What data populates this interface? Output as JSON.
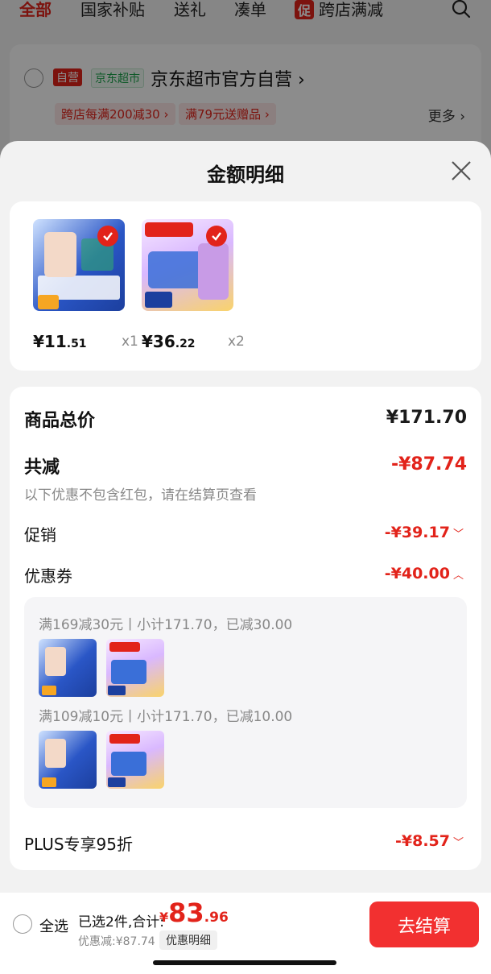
{
  "background": {
    "tabs": [
      "全部",
      "国家补贴",
      "送礼",
      "凑单"
    ],
    "promo_tab_badge": "促",
    "promo_tab_label": "跨店满减",
    "store": {
      "tag_self": "自营",
      "tag_supermarket": "京东超市",
      "name": "京东超市官方自营",
      "promos": [
        "跨店每满200减30",
        "满79元送赠品"
      ],
      "more": "更多"
    }
  },
  "sheet": {
    "title": "金额明细",
    "products": [
      {
        "price_int": "¥11",
        "price_dec": ".51",
        "qty": "x1",
        "image": "tissue-pack-blue"
      },
      {
        "price_int": "¥36",
        "price_dec": ".22",
        "qty": "x2",
        "image": "tissue-pack-purple"
      }
    ],
    "rows": {
      "total_label": "商品总价",
      "total_value": "¥171.70",
      "discount_label": "共减",
      "discount_value": "-¥87.74",
      "discount_note": "以下优惠不包含红包，请在结算页查看",
      "promo_label": "促销",
      "promo_value": "-¥39.17",
      "coupon_label": "优惠券",
      "coupon_value": "-¥40.00",
      "coupons": [
        {
          "text": "满169减30元丨小计171.70，已减30.00"
        },
        {
          "text": "满109减10元丨小计171.70，已减10.00"
        }
      ],
      "plus_label": "PLUS专享95折",
      "plus_value": "-¥8.57"
    }
  },
  "bottom": {
    "select_all": "全选",
    "summary_prefix": "已选2件,合计:",
    "total_yen": "¥",
    "total_int": "83",
    "total_dec": ".96",
    "saved": "优惠减:¥87.74",
    "detail_chip": "优惠明细",
    "checkout": "去结算"
  },
  "colors": {
    "accent": "#e2231a",
    "checkout": "#f23030"
  }
}
